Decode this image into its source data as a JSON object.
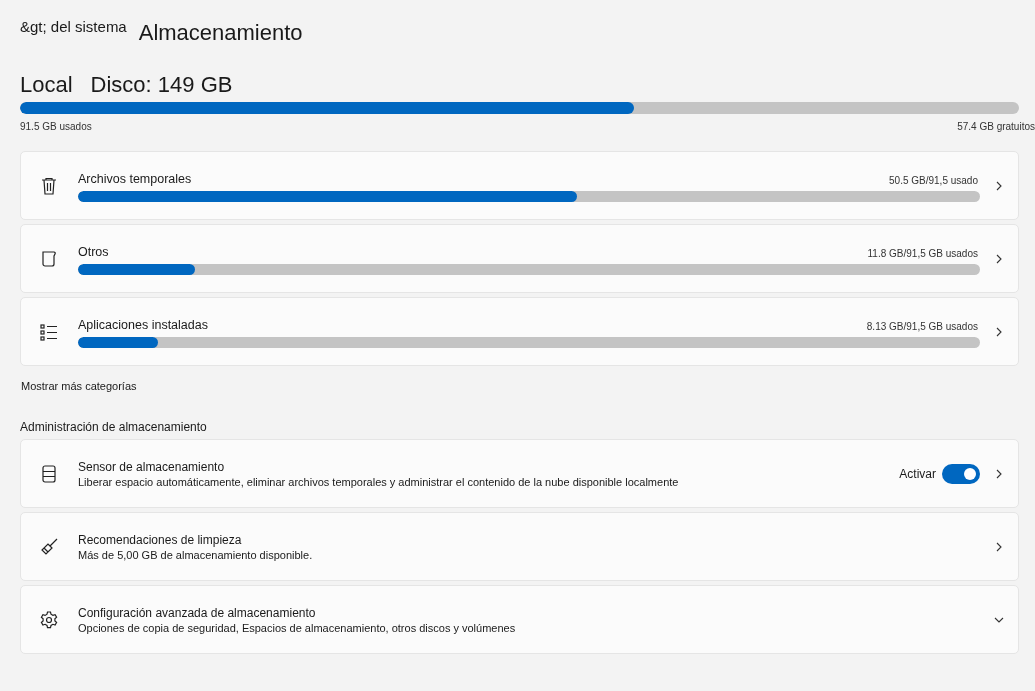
{
  "breadcrumb": "&gt; del sistema",
  "title": "Almacenamiento",
  "disk": {
    "label": "Local",
    "name": "Disco: 149 GB",
    "level": 0.615,
    "used": "91.5 GB usados",
    "free": "57.4 GB gratuitos"
  },
  "categories": [
    {
      "name": "Archivos temporales",
      "reading": "50.5 GB/91,5 usado",
      "level": 0.553
    },
    {
      "name": "Otros",
      "reading": "11.8 GB/91,5 GB usados",
      "level": 0.13
    },
    {
      "name": "Aplicaciones instaladas",
      "reading": "8.13 GB/91,5 GB usados",
      "level": 0.089
    }
  ],
  "more_link": "Mostrar más categorías",
  "management": {
    "heading": "Administración de almacenamiento",
    "items": [
      {
        "kind": "toggle",
        "title": "Sensor de almacenamiento",
        "description": "Liberar espacio automáticamente, eliminar archivos temporales y administrar el contenido de la nube disponible localmente",
        "toggle_label": "Activar",
        "on": true
      },
      {
        "kind": "link",
        "title": "Recomendaciones de limpieza",
        "description": "Más de 5,00 GB de almacenamiento disponible."
      },
      {
        "kind": "expand",
        "title": "Configuración avanzada de almacenamiento",
        "description": "Opciones de copia de seguridad, Espacios de almacenamiento, otros discos y volúmenes"
      }
    ]
  }
}
